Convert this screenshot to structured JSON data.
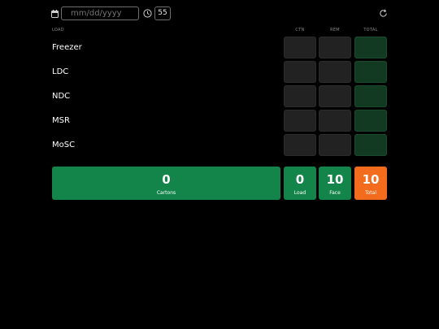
{
  "toolbar": {
    "date_placeholder": "mm/dd/yyyy",
    "minutes_value": "55",
    "icons": [
      "calendar-icon",
      "clock-icon",
      "refresh-icon"
    ]
  },
  "table": {
    "headers": {
      "load": "LOAD",
      "ctn": "CTN",
      "rem": "REM",
      "total": "TOTAL"
    },
    "rows": [
      {
        "label": "Freezer"
      },
      {
        "label": "LDC"
      },
      {
        "label": "NDC"
      },
      {
        "label": "MSR"
      },
      {
        "label": "MoSC"
      }
    ]
  },
  "summary": {
    "cartons": {
      "value": "0",
      "label": "Cartons"
    },
    "load": {
      "value": "0",
      "label": "Load"
    },
    "face": {
      "value": "10",
      "label": "Face"
    },
    "total": {
      "value": "10",
      "label": "Total"
    }
  },
  "colors": {
    "background": "#000000",
    "green": "#14854a",
    "dark_green_cell": "#123a22",
    "orange": "#f36b1c",
    "grey_cell": "#222222"
  }
}
